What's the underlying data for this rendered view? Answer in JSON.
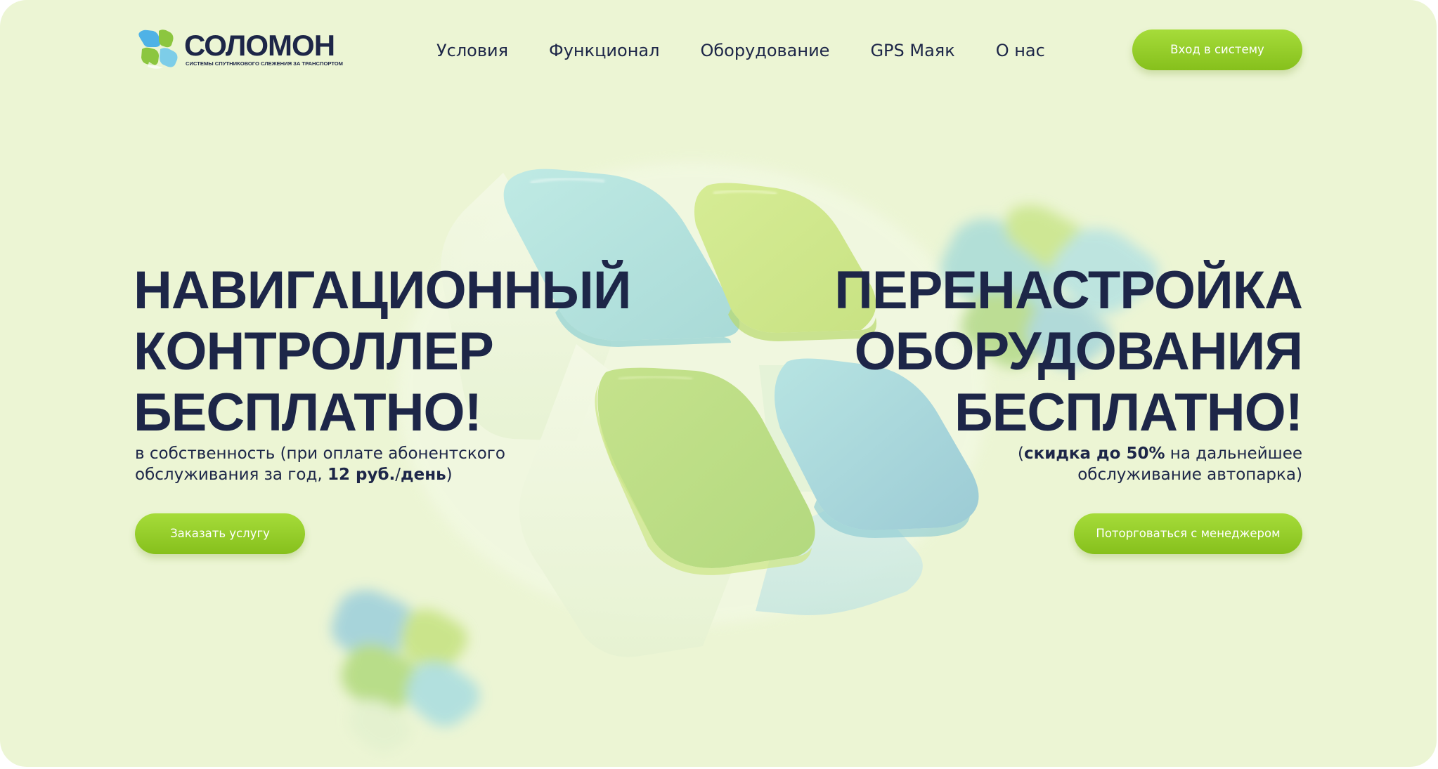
{
  "brand": {
    "name": "СОЛОМОН",
    "tagline": "СИСТЕМЫ СПУТНИКОВОГО СЛЕЖЕНИЯ ЗА ТРАНСПОРТОМ"
  },
  "nav": [
    {
      "label": "Условия"
    },
    {
      "label": "Функционал"
    },
    {
      "label": "Оборудование"
    },
    {
      "label": "GPS Маяк"
    },
    {
      "label": "О нас"
    }
  ],
  "header": {
    "login_button": "Вход в систему"
  },
  "offer_left": {
    "lines": [
      "НАВИГАЦИОННЫЙ",
      "КОНТРОЛЛЕР",
      "БЕСПЛАТНО!"
    ],
    "sub_line1": "в собственность (при оплате абонентского",
    "sub_line2_prefix": "обслуживания за год, ",
    "sub_line2_bold1": "12 руб.",
    "sub_line2_sep": "/",
    "sub_line2_bold2": "день",
    "sub_line2_suffix": ")",
    "button": "Заказать услугу"
  },
  "offer_right": {
    "lines": [
      "ПЕРЕНАСТРОЙКА",
      "ОБОРУДОВАНИЯ",
      "БЕСПЛАТНО!"
    ],
    "sub_line1_prefix": "(",
    "sub_line1_bold": "скидка до 50%",
    "sub_line1_suffix": " на дальнейшее",
    "sub_line2": "обслуживание автопарка)",
    "button": "Поторговаться с менеджером"
  },
  "colors": {
    "background": "#ecf5d4",
    "text": "#1d2648",
    "accent_green": "#8cc625",
    "tile_blue": "#b3e3e0",
    "tile_green": "#cde68c"
  }
}
